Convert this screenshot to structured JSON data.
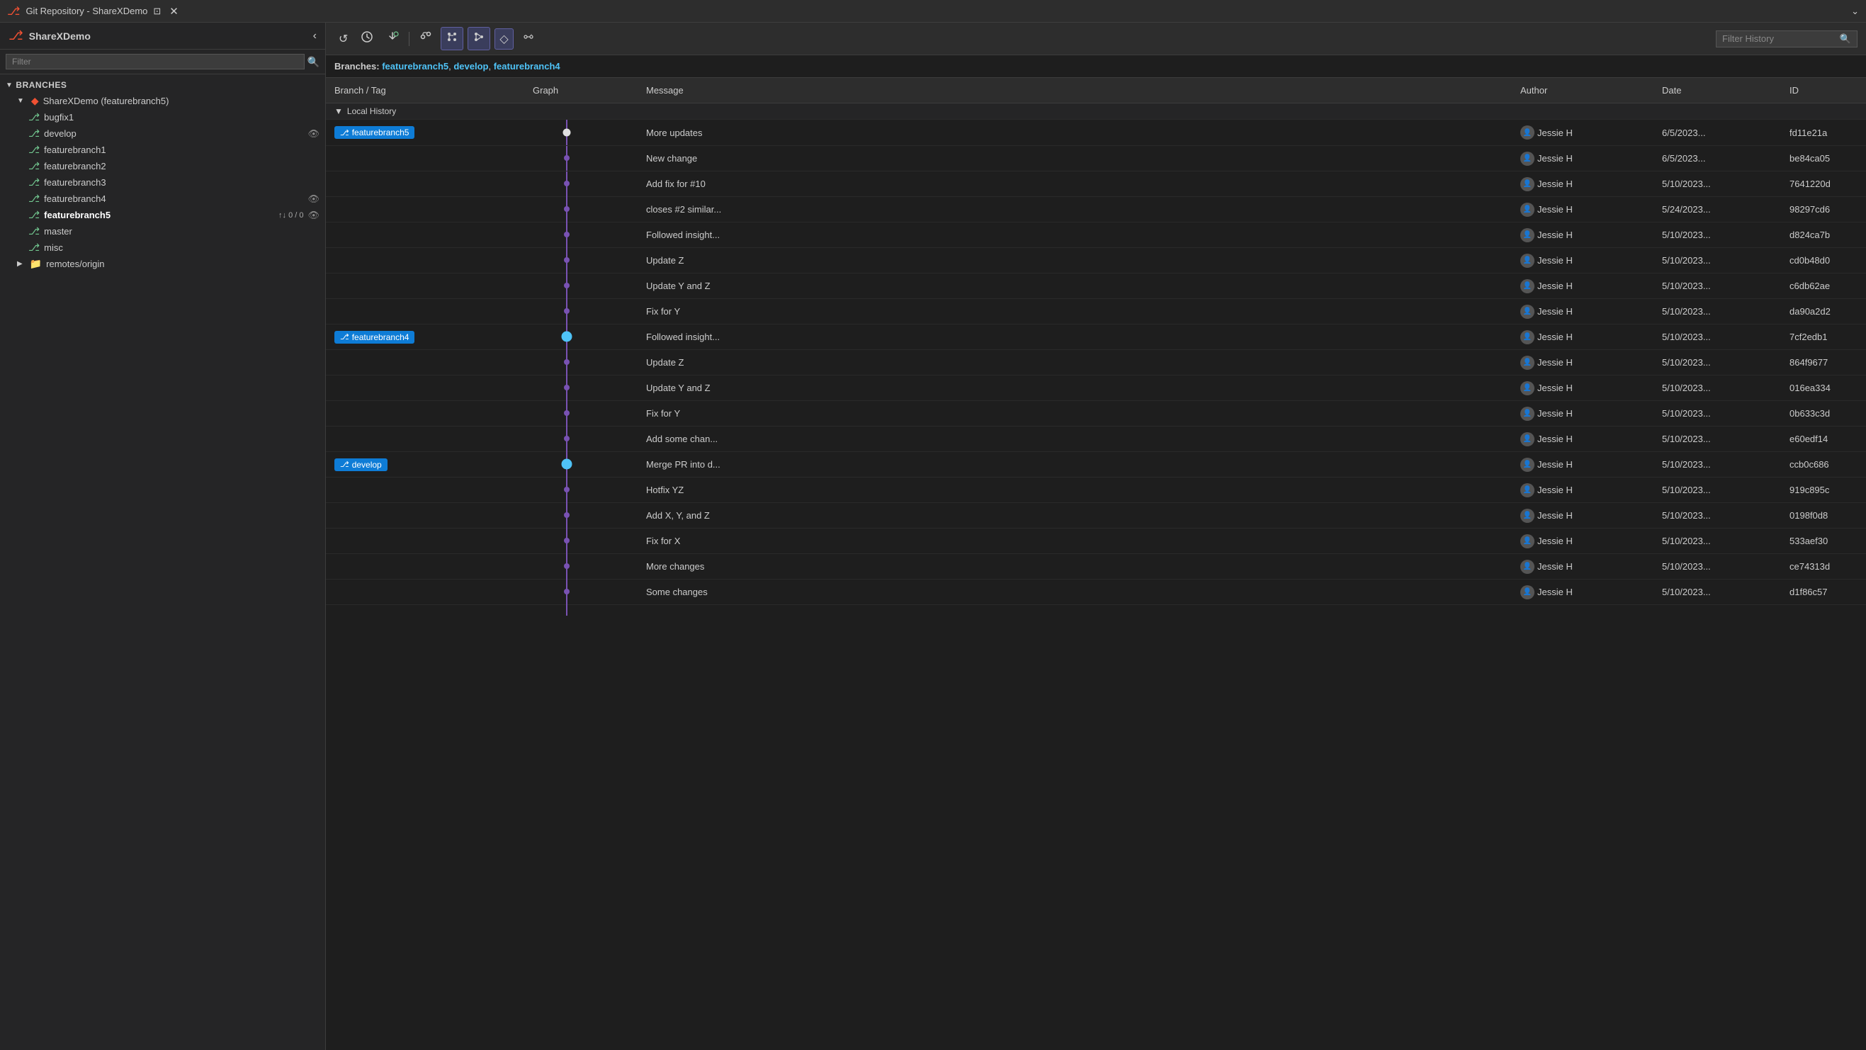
{
  "titleBar": {
    "icon": "⎇",
    "title": "Git Repository - ShareXDemo",
    "pinLabel": "⊡",
    "closeLabel": "✕",
    "chevronLabel": "⌄"
  },
  "sidebar": {
    "headerIcon": "⎇",
    "headerTitle": "ShareXDemo",
    "collapseLabel": "‹",
    "filterPlaceholder": "Filter",
    "filterIconLabel": "🔍",
    "sectionLabel": "Branches",
    "rootItem": {
      "label": "ShareXDemo (featurebranch5)",
      "icon": "◆"
    },
    "branches": [
      {
        "label": "bugfix1",
        "bold": false,
        "rightIcons": []
      },
      {
        "label": "develop",
        "bold": false,
        "rightIcons": [
          "👁"
        ]
      },
      {
        "label": "featurebranch1",
        "bold": false,
        "rightIcons": []
      },
      {
        "label": "featurebranch2",
        "bold": false,
        "rightIcons": []
      },
      {
        "label": "featurebranch3",
        "bold": false,
        "rightIcons": []
      },
      {
        "label": "featurebranch4",
        "bold": false,
        "rightIcons": [
          "👁"
        ]
      },
      {
        "label": "featurebranch5",
        "bold": true,
        "badge": "↑↓ 0 / 0",
        "rightIcons": [
          "👁"
        ]
      },
      {
        "label": "master",
        "bold": false,
        "rightIcons": []
      },
      {
        "label": "misc",
        "bold": false,
        "rightIcons": []
      }
    ],
    "remotes": {
      "label": "remotes/origin",
      "collapsed": true
    }
  },
  "toolbar": {
    "buttons": [
      {
        "name": "refresh",
        "label": "↺",
        "active": false
      },
      {
        "name": "fetch",
        "label": "↙",
        "active": false
      },
      {
        "name": "pull",
        "label": "↓⎇",
        "active": false
      },
      {
        "name": "branch-graph",
        "label": "⎇⎇",
        "active": false
      },
      {
        "name": "layout1",
        "label": "⊞",
        "active": true
      },
      {
        "name": "layout2",
        "label": "⊟",
        "active": true
      },
      {
        "name": "tag",
        "label": "◇",
        "active": true
      },
      {
        "name": "remote-branches",
        "label": "👁⎇",
        "active": false
      }
    ],
    "filterPlaceholder": "Filter History",
    "filterIconLabel": "🔍"
  },
  "branches_bar": {
    "label": "Branches:",
    "branches": [
      "featurebranch5",
      "develop",
      "featurebranch4"
    ]
  },
  "table": {
    "headers": [
      "Branch / Tag",
      "Graph",
      "Message",
      "Author",
      "Date",
      "ID"
    ],
    "localHistoryLabel": "Local History",
    "rows": [
      {
        "branchTag": "featurebranch5",
        "graphNode": "white",
        "message": "More updates",
        "author": "Jessie H",
        "date": "6/5/2023...",
        "id": "fd11e21a"
      },
      {
        "branchTag": "",
        "graphNode": "line",
        "message": "New change",
        "author": "Jessie H",
        "date": "6/5/2023...",
        "id": "be84ca05"
      },
      {
        "branchTag": "",
        "graphNode": "line",
        "message": "Add fix for #10",
        "author": "Jessie H",
        "date": "5/10/2023...",
        "id": "7641220d"
      },
      {
        "branchTag": "",
        "graphNode": "line",
        "message": "closes #2 similar...",
        "author": "Jessie H",
        "date": "5/24/2023...",
        "id": "98297cd6"
      },
      {
        "branchTag": "",
        "graphNode": "line",
        "message": "Followed insight...",
        "author": "Jessie H",
        "date": "5/10/2023...",
        "id": "d824ca7b"
      },
      {
        "branchTag": "",
        "graphNode": "line",
        "message": "Update Z",
        "author": "Jessie H",
        "date": "5/10/2023...",
        "id": "cd0b48d0"
      },
      {
        "branchTag": "",
        "graphNode": "line",
        "message": "Update Y and Z",
        "author": "Jessie H",
        "date": "5/10/2023...",
        "id": "c6db62ae"
      },
      {
        "branchTag": "",
        "graphNode": "line",
        "message": "Fix for Y",
        "author": "Jessie H",
        "date": "5/10/2023...",
        "id": "da90a2d2"
      },
      {
        "branchTag": "featurebranch4",
        "graphNode": "blue",
        "message": "Followed insight...",
        "author": "Jessie H",
        "date": "5/10/2023...",
        "id": "7cf2edb1"
      },
      {
        "branchTag": "",
        "graphNode": "line",
        "message": "Update Z",
        "author": "Jessie H",
        "date": "5/10/2023...",
        "id": "864f9677"
      },
      {
        "branchTag": "",
        "graphNode": "line",
        "message": "Update Y and Z",
        "author": "Jessie H",
        "date": "5/10/2023...",
        "id": "016ea334"
      },
      {
        "branchTag": "",
        "graphNode": "line",
        "message": "Fix for Y",
        "author": "Jessie H",
        "date": "5/10/2023...",
        "id": "0b633c3d"
      },
      {
        "branchTag": "",
        "graphNode": "line",
        "message": "Add some chan...",
        "author": "Jessie H",
        "date": "5/10/2023...",
        "id": "e60edf14"
      },
      {
        "branchTag": "develop",
        "graphNode": "blue",
        "message": "Merge PR into d...",
        "author": "Jessie H",
        "date": "5/10/2023...",
        "id": "ccb0c686"
      },
      {
        "branchTag": "",
        "graphNode": "line",
        "message": "Hotfix YZ",
        "author": "Jessie H",
        "date": "5/10/2023...",
        "id": "919c895c"
      },
      {
        "branchTag": "",
        "graphNode": "line",
        "message": "Add X, Y, and Z",
        "author": "Jessie H",
        "date": "5/10/2023...",
        "id": "0198f0d8"
      },
      {
        "branchTag": "",
        "graphNode": "line",
        "message": "Fix for X",
        "author": "Jessie H",
        "date": "5/10/2023...",
        "id": "533aef30"
      },
      {
        "branchTag": "",
        "graphNode": "line",
        "message": "More changes",
        "author": "Jessie H",
        "date": "5/10/2023...",
        "id": "ce74313d"
      },
      {
        "branchTag": "",
        "graphNode": "line",
        "message": "Some changes",
        "author": "Jessie H",
        "date": "5/10/2023...",
        "id": "d1f86c57"
      }
    ]
  },
  "colors": {
    "accent": "#0e7cd6",
    "orange": "#f05133",
    "green": "#73c991",
    "purple": "#7952b3",
    "graphLine": "#7952b3",
    "graphNodeWhite": "#e0e0e0",
    "graphNodeBlue": "#4fc3f7"
  }
}
